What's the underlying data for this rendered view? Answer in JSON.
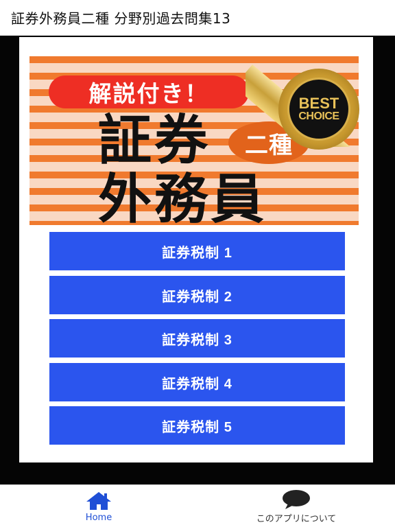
{
  "app_bar": {
    "title": "証券外務員二種 分野別過去問集13"
  },
  "banner": {
    "pill_text": "解説付き！",
    "word_top": "証券",
    "circle_text": "二種",
    "word_bottom": "外務員",
    "badge_line1": "BEST",
    "badge_line2": "CHOICE"
  },
  "menu": {
    "buttons": [
      {
        "label": "証券税制 1"
      },
      {
        "label": "証券税制 2"
      },
      {
        "label": "証券税制 3"
      },
      {
        "label": "証券税制 4"
      },
      {
        "label": "証券税制 5"
      }
    ]
  },
  "bottom_nav": {
    "items": [
      {
        "label": "Home",
        "icon": "home-icon"
      },
      {
        "label": "このアプリについて",
        "icon": "speech-bubble-icon"
      }
    ]
  },
  "colors": {
    "accent_blue": "#2b55ee",
    "stripe_orange": "#f07a2e",
    "pill_red": "#ee2e24",
    "circle_orange": "#e2631b",
    "gold": "#d9b04a",
    "nav_active": "#1f4fd6"
  }
}
